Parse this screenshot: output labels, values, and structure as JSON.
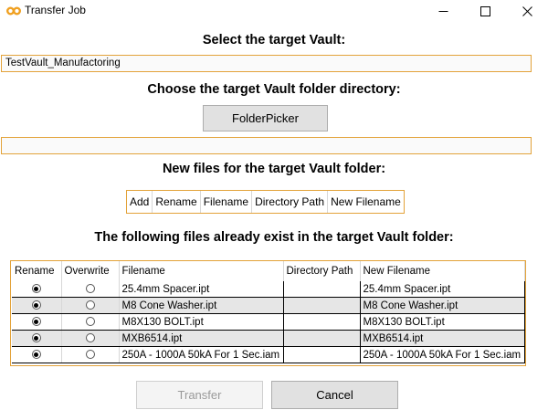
{
  "window": {
    "title": "Transfer Job",
    "controls": {
      "minimize": "—",
      "maximize": "☐",
      "close": "✕"
    }
  },
  "vault": {
    "heading": "Select the target Vault:",
    "value": "TestVault_Manufactoring"
  },
  "folder": {
    "heading": "Choose the target Vault folder directory:",
    "picker_label": "FolderPicker",
    "value": ""
  },
  "new_files": {
    "heading": "New files for the target Vault folder:",
    "columns": [
      "Add",
      "Rename",
      "Filename",
      "Directory Path",
      "New Filename"
    ]
  },
  "existing_files": {
    "heading": "The following files already exist in the target Vault folder:",
    "columns": [
      "Rename",
      "Overwrite",
      "Filename",
      "Directory Path",
      "New Filename"
    ],
    "rows": [
      {
        "rename": true,
        "overwrite": false,
        "filename": "25.4mm Spacer.ipt",
        "directory": "",
        "new_filename": "25.4mm Spacer.ipt"
      },
      {
        "rename": true,
        "overwrite": false,
        "filename": "M8 Cone Washer.ipt",
        "directory": "",
        "new_filename": "M8 Cone Washer.ipt"
      },
      {
        "rename": true,
        "overwrite": false,
        "filename": "M8X130 BOLT.ipt",
        "directory": "",
        "new_filename": "M8X130 BOLT.ipt"
      },
      {
        "rename": true,
        "overwrite": false,
        "filename": "MXB6514.ipt",
        "directory": "",
        "new_filename": "MXB6514.ipt"
      },
      {
        "rename": true,
        "overwrite": false,
        "filename": "250A - 1000A 50kA For 1 Sec.iam",
        "directory": "",
        "new_filename": "250A - 1000A 50kA For 1 Sec.iam"
      }
    ]
  },
  "actions": {
    "transfer_label": "Transfer",
    "transfer_enabled": false,
    "cancel_label": "Cancel"
  },
  "colors": {
    "accent_border": "#e3a33a",
    "app_icon": "#f0a020"
  }
}
